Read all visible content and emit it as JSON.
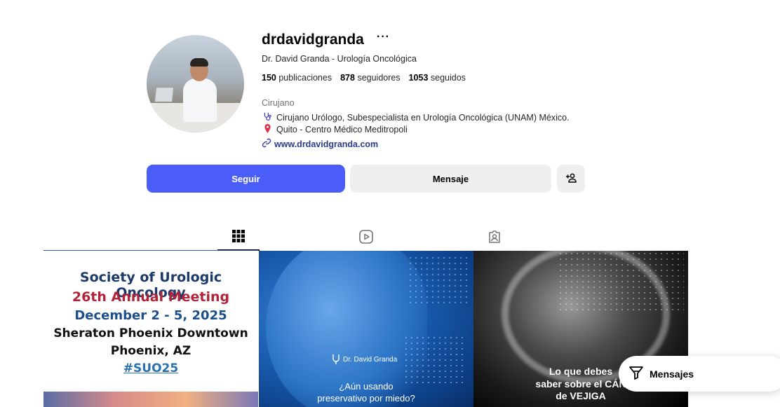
{
  "profile": {
    "username": "drdavidgranda",
    "more_label": "···",
    "full_name": "Dr. David Granda - Urología Oncológica",
    "stats": {
      "posts_count": "150",
      "posts_label": "publicaciones",
      "followers_count": "878",
      "followers_label": "seguidores",
      "following_count": "1053",
      "following_label": "seguidos"
    },
    "category": "Cirujano",
    "bio_line1": "Cirujano Urólogo, Subespecialista en Urología Oncológica (UNAM) México.",
    "bio_line2": "Quito - Centro Médico Meditropoli",
    "website": "www.drdavidgranda.com"
  },
  "actions": {
    "follow_label": "Seguir",
    "message_label": "Mensaje"
  },
  "posts": [
    {
      "lines": [
        "Society of Urologic Oncology",
        "26th Annual Meeting",
        "December 2 - 5, 2025",
        "Sheraton Phoenix Downtown",
        "Phoenix, AZ",
        "#SUO25"
      ]
    },
    {
      "brand": "Dr. David Granda",
      "line1": "¿Aún usando",
      "line2": "preservativo por miedo?"
    },
    {
      "line1": "Lo que debes",
      "line2": "saber sobre el CÁN",
      "line3": "de VEJIGA"
    }
  ],
  "messages_button": {
    "label": "Mensajes"
  },
  "icons": {
    "stethoscope": "stethoscope-icon",
    "pin": "location-pin-icon",
    "link": "link-icon",
    "add_person": "add-person-icon",
    "grid": "grid-icon",
    "reels": "reels-icon",
    "tagged": "tagged-icon",
    "filter": "filter-icon"
  },
  "colors": {
    "follow_button": "#4a5df9",
    "secondary_button": "#efefef",
    "link": "#2c3a8c"
  }
}
